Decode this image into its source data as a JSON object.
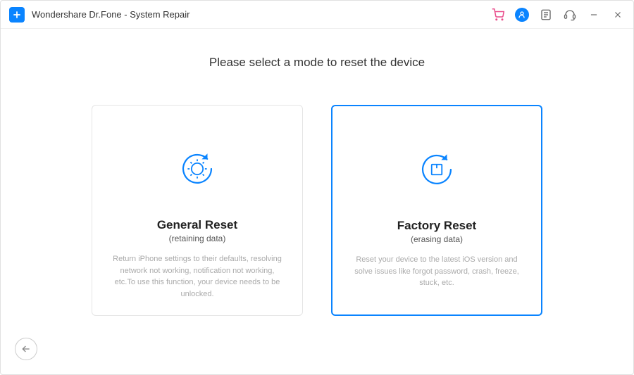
{
  "app": {
    "title": "Wondershare Dr.Fone - System Repair"
  },
  "page": {
    "heading": "Please select a mode to reset the device"
  },
  "cards": {
    "general": {
      "title": "General Reset",
      "subtitle": "(retaining data)",
      "desc": "Return iPhone settings to their defaults, resolving network not working, notification not working, etc.To use this function, your device needs to be unlocked."
    },
    "factory": {
      "title": "Factory Reset",
      "subtitle": "(erasing data)",
      "desc": "Reset your device to the latest iOS version and solve issues like forgot password, crash, freeze, stuck, etc."
    }
  },
  "icons": {
    "cart": "cart-icon",
    "user": "user-icon",
    "feedback": "feedback-icon",
    "support": "support-icon",
    "minimize": "minimize-icon",
    "close": "close-icon",
    "back": "back-icon"
  }
}
